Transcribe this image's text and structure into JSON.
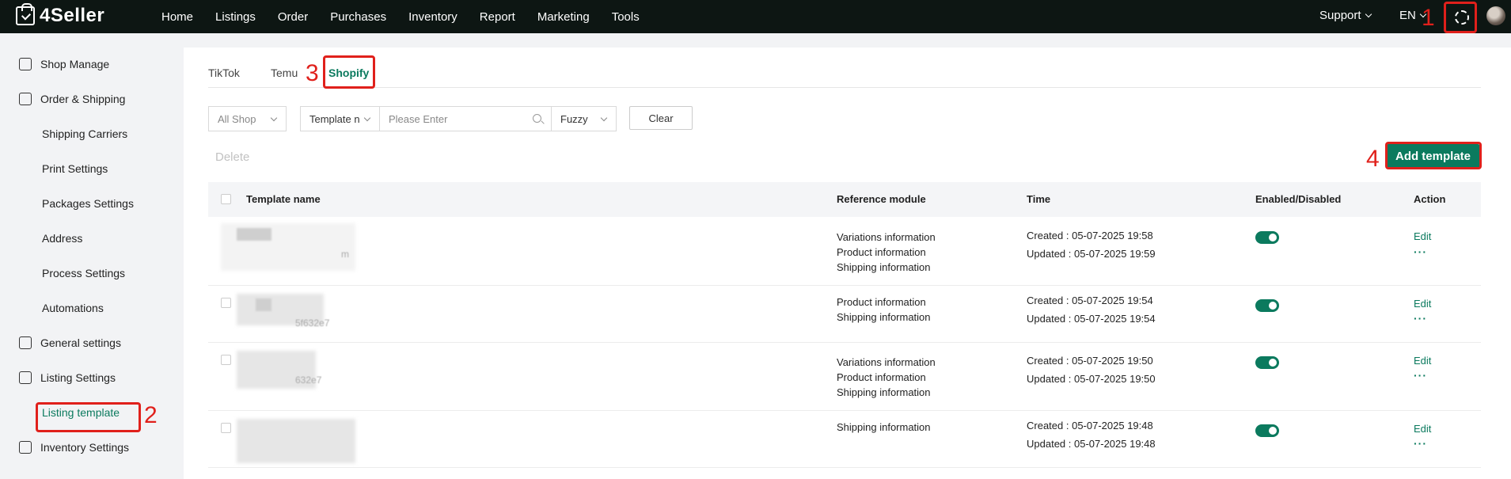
{
  "app": {
    "name": "4Seller"
  },
  "nav": [
    "Home",
    "Listings",
    "Order",
    "Purchases",
    "Inventory",
    "Report",
    "Marketing",
    "Tools"
  ],
  "topright": {
    "support": "Support",
    "lang": "EN"
  },
  "sidebar": {
    "items": [
      {
        "label": "Shop Manage",
        "icon": "shop-icon"
      },
      {
        "label": "Order & Shipping",
        "icon": "order-icon"
      },
      {
        "label": "Shipping Carriers"
      },
      {
        "label": "Print Settings"
      },
      {
        "label": "Packages Settings"
      },
      {
        "label": "Address"
      },
      {
        "label": "Process Settings"
      },
      {
        "label": "Automations"
      },
      {
        "label": "General settings",
        "icon": "general-settings-icon"
      },
      {
        "label": "Listing Settings",
        "icon": "listing-settings-icon"
      },
      {
        "label": "Listing template",
        "active": true
      },
      {
        "label": "Inventory Settings",
        "icon": "inventory-icon"
      }
    ]
  },
  "tabs": [
    "TikTok",
    "Temu",
    "Shopify"
  ],
  "filters": {
    "shop": "All Shop",
    "field": "Template n",
    "search_placeholder": "Please Enter",
    "match": "Fuzzy",
    "clear": "Clear"
  },
  "toolbar": {
    "delete": "Delete",
    "add": "Add template"
  },
  "table": {
    "headers": [
      "Template name",
      "Reference module",
      "Time",
      "Enabled/Disabled",
      "Action"
    ],
    "rows": [
      {
        "name_fragment": "m",
        "modules": [
          "Variations information",
          "Product information",
          "Shipping information"
        ],
        "created": "Created : 05-07-2025 19:58",
        "updated": "Updated : 05-07-2025 19:59",
        "enabled": true,
        "edit": "Edit",
        "more": "···"
      },
      {
        "name_fragment": "5f632e7",
        "modules": [
          "Product information",
          "Shipping information"
        ],
        "created": "Created : 05-07-2025 19:54",
        "updated": "Updated : 05-07-2025 19:54",
        "enabled": true,
        "edit": "Edit",
        "more": "···"
      },
      {
        "name_fragment": "632e7",
        "modules": [
          "Variations information",
          "Product information",
          "Shipping information"
        ],
        "created": "Created : 05-07-2025 19:50",
        "updated": "Updated : 05-07-2025 19:50",
        "enabled": true,
        "edit": "Edit",
        "more": "···"
      },
      {
        "name_fragment": "",
        "modules": [
          "Shipping information"
        ],
        "created": "Created : 05-07-2025 19:48",
        "updated": "Updated : 05-07-2025 19:48",
        "enabled": true,
        "edit": "Edit",
        "more": "···"
      }
    ]
  },
  "annotations": [
    "1",
    "2",
    "3",
    "4"
  ],
  "colors": {
    "brand": "#0b7a5e",
    "topbar": "#0d1613",
    "annotation": "#e0201b"
  }
}
